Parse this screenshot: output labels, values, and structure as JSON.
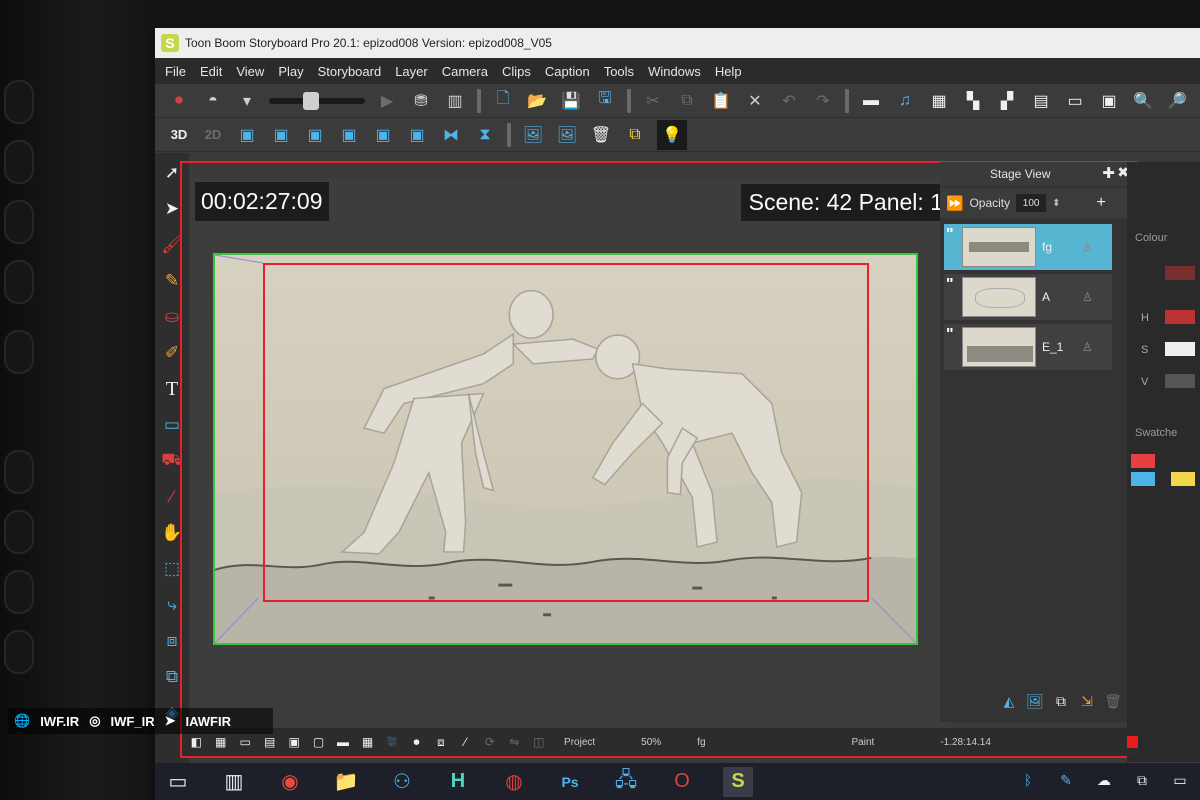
{
  "window": {
    "logo": "S",
    "title": "Toon Boom Storyboard Pro 20.1: epizod008 Version: epizod008_V05"
  },
  "menu": [
    "File",
    "Edit",
    "View",
    "Play",
    "Storyboard",
    "Layer",
    "Camera",
    "Clips",
    "Caption",
    "Tools",
    "Windows",
    "Help"
  ],
  "toolbar_top_icons": [
    "record-icon",
    "onion-skin-icon",
    "play-icon",
    "stamp-icon",
    "paste-special-icon",
    "new-project-icon",
    "open-folder-icon",
    "save-icon",
    "save-as-icon",
    "cut-icon",
    "copy-icon",
    "paste-icon",
    "delete-icon",
    "undo-icon",
    "redo-icon",
    "filmstrip-icon",
    "sound-icon",
    "grid-view-icon",
    "panel-view-icon",
    "thumbnails-icon",
    "layout-icon",
    "timeline-icon",
    "overlay-icon",
    "zoom-in-icon",
    "zoom-out-icon"
  ],
  "toolbar_bottom_icons": [
    "3d-icon",
    "2d-icon",
    "add-panel-icon",
    "add-panel-before-icon",
    "duplicate-panel-icon",
    "split-panel-icon",
    "merge-panel-icon",
    "new-scene-icon",
    "join-scene-icon",
    "transition-icon",
    "import-image-icon",
    "export-image-icon",
    "trash-icon",
    "copy-layer-icon",
    "lightbulb-icon"
  ],
  "tools": [
    "select-arrow-icon",
    "transform-arrow-icon",
    "brush-icon",
    "pencil-icon",
    "stamp-tool-icon",
    "eraser-icon",
    "text-tool-icon",
    "rectangle-tool-icon",
    "paint-bucket-icon",
    "eyedropper-icon",
    "hand-tool-icon",
    "contour-editor-icon",
    "cutter-icon",
    "reposition-icon",
    "camera-tool-icon",
    "morph-icon"
  ],
  "stage": {
    "timecode": "00:02:27:09",
    "scene_panel": "Scene: 42 Panel: 1"
  },
  "layers_panel": {
    "title": "Stage View",
    "opacity_label": "Opacity",
    "opacity_value": "100",
    "layers": [
      {
        "name": "fg",
        "selected": true
      },
      {
        "name": "A",
        "selected": false
      },
      {
        "name": "E_1",
        "selected": false
      }
    ]
  },
  "colour_panel": {
    "section_colour": "Colour",
    "section_swatches": "Swatche",
    "letters": [
      "H",
      "S",
      "V"
    ],
    "swatch_colors": [
      "#e84040",
      "#4fb2e8",
      "#f3d64c",
      "#e8e8e8"
    ]
  },
  "statusbar": {
    "project": "Project",
    "zoom": "50%",
    "layer": "fg",
    "mode": "Paint",
    "coordinates": "-1.28:14.14"
  },
  "taskbar_icons": [
    "task-view-icon",
    "chrome-icon",
    "file-explorer-icon",
    "connect-icon",
    "h-app-icon",
    "messenger-icon",
    "photoshop-icon",
    "network-icon",
    "opera-icon",
    "storyboard-pro-icon"
  ],
  "watermark": {
    "site": "IWF.IR",
    "instagram": "IWF_IR",
    "telegram": "IAWFIR"
  },
  "colors": {
    "accent_red": "#e8202a",
    "camera_green": "#3cc43c",
    "selected_layer": "#56b6d2"
  }
}
